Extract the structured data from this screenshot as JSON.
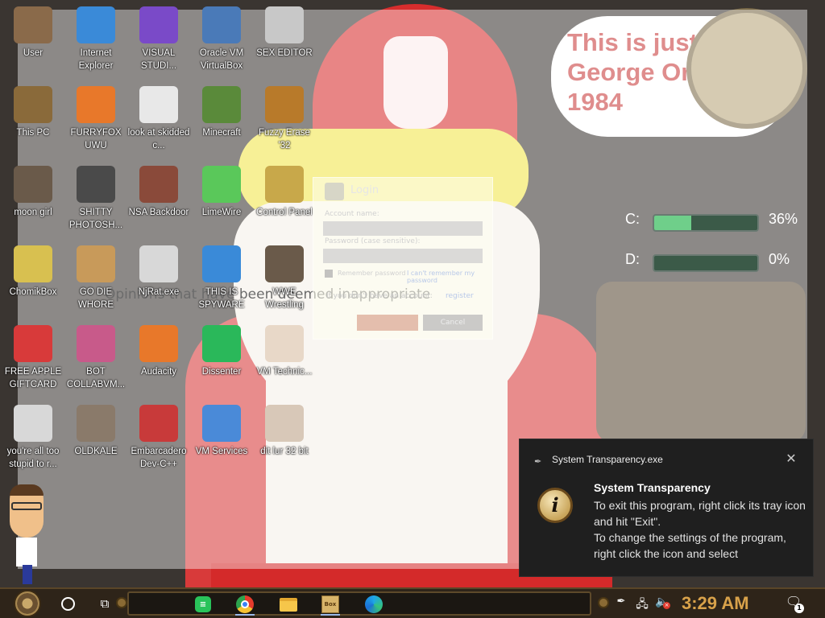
{
  "wallpaper": {
    "speech_text": "This is just George Orwell's 1984",
    "banner_text": "Opinions that have been deemed inappropriate"
  },
  "gauges": [
    {
      "letter": "C:",
      "percent_text": "36%",
      "fill": 0.36
    },
    {
      "letter": "D:",
      "percent_text": "0%",
      "fill": 0.0
    }
  ],
  "desktop_icons": [
    {
      "label": "User",
      "icon": "user-folder-icon",
      "color": "#8a6a4a"
    },
    {
      "label": "Internet Explorer",
      "icon": "internet-explorer-icon",
      "color": "#3a8ad8"
    },
    {
      "label": "VISUAL STUDI...",
      "icon": "visual-studio-icon",
      "color": "#7a4ac8"
    },
    {
      "label": "Oracle VM VirtualBox",
      "icon": "virtualbox-icon",
      "color": "#4a7ab8"
    },
    {
      "label": "SEX EDITOR",
      "icon": "hex-editor-icon",
      "color": "#c8c8c8"
    },
    {
      "label": "This PC",
      "icon": "this-pc-icon",
      "color": "#8a6a3a"
    },
    {
      "label": "FURRYFOX UWU",
      "icon": "firefox-icon",
      "color": "#e8782a"
    },
    {
      "label": "look at skidded c...",
      "icon": "files-icon",
      "color": "#e8e8e8"
    },
    {
      "label": "Minecraft",
      "icon": "minecraft-icon",
      "color": "#5a8a3a"
    },
    {
      "label": "Fuzzy Erase '32",
      "icon": "headphones-icon",
      "color": "#b87a2a"
    },
    {
      "label": "moon girl",
      "icon": "image-icon",
      "color": "#6a5a4a"
    },
    {
      "label": "SHITTY PHOTOSH...",
      "icon": "photoshop-icon",
      "color": "#4a4a4a"
    },
    {
      "label": "NSA Backdoor",
      "icon": "backdoor-icon",
      "color": "#8a4a3a"
    },
    {
      "label": "LimeWire",
      "icon": "limewire-icon",
      "color": "#5ac85a"
    },
    {
      "label": "Control Panel",
      "icon": "control-panel-icon",
      "color": "#c8a84a"
    },
    {
      "label": "ChomikBox",
      "icon": "chomikbox-icon",
      "color": "#d8c050"
    },
    {
      "label": "GO DIE WHORE",
      "icon": "dieman-icon",
      "color": "#c89a5a"
    },
    {
      "label": "NjRat.exe",
      "icon": "skull-icon",
      "color": "#d8d8d8"
    },
    {
      "label": "THIS IS SPYWARE",
      "icon": "chrome-icon",
      "color": "#3a8ad8"
    },
    {
      "label": "WWE Wrestling",
      "icon": "tv-icon",
      "color": "#6a5a4a"
    },
    {
      "label": "FREE APPLE GIFTCARD",
      "icon": "apple-icon",
      "color": "#d83a3a"
    },
    {
      "label": "BOT COLLABVM...",
      "icon": "winrar-icon",
      "color": "#c85a8a"
    },
    {
      "label": "Audacity",
      "icon": "audacity-icon",
      "color": "#e8782a"
    },
    {
      "label": "Dissenter",
      "icon": "dissenter-icon",
      "color": "#2ab85a"
    },
    {
      "label": "VM Technic...",
      "icon": "person-icon",
      "color": "#e8d8c8"
    },
    {
      "label": "you're all too stupid to r...",
      "icon": "portrait-icon",
      "color": "#d8d8d8"
    },
    {
      "label": "OLDKALE",
      "icon": "doc-icon",
      "color": "#8a7a6a"
    },
    {
      "label": "Embarcadero Dev-C++",
      "icon": "devcpp-icon",
      "color": "#c83a3a"
    },
    {
      "label": "VM Services",
      "icon": "windows-shield-icon",
      "color": "#4a8ad8"
    },
    {
      "label": "dit lur 32 bit",
      "icon": "portrait-icon",
      "color": "#d8c8b8"
    }
  ],
  "login": {
    "title": "Login",
    "account_label": "Account name:",
    "password_label": "Password (case sensitive):",
    "remember": "Remember password",
    "forgot": "I can't remember my password",
    "no_account": "If you don't have an account:",
    "register": "register",
    "cancel": "Cancel"
  },
  "toast": {
    "app_name": "System Transparency.exe",
    "title": "System Transparency",
    "body_1": "To exit this program, right click its tray icon and hit \"Exit\".",
    "body_2": "To change the settings of the program, right click the icon and select"
  },
  "taskbar": {
    "clock": "3:29 AM",
    "notification_count": "1",
    "apps": [
      {
        "name": "Dissenter",
        "icon": "chat-app-icon"
      },
      {
        "name": "Google Chrome",
        "icon": "chrome-icon"
      },
      {
        "name": "File Explorer",
        "icon": "folder-icon"
      },
      {
        "name": "ChomikBox",
        "icon": "box-app-icon"
      },
      {
        "name": "Microsoft Edge",
        "icon": "edge-icon"
      }
    ],
    "box_app_text": "Box"
  }
}
